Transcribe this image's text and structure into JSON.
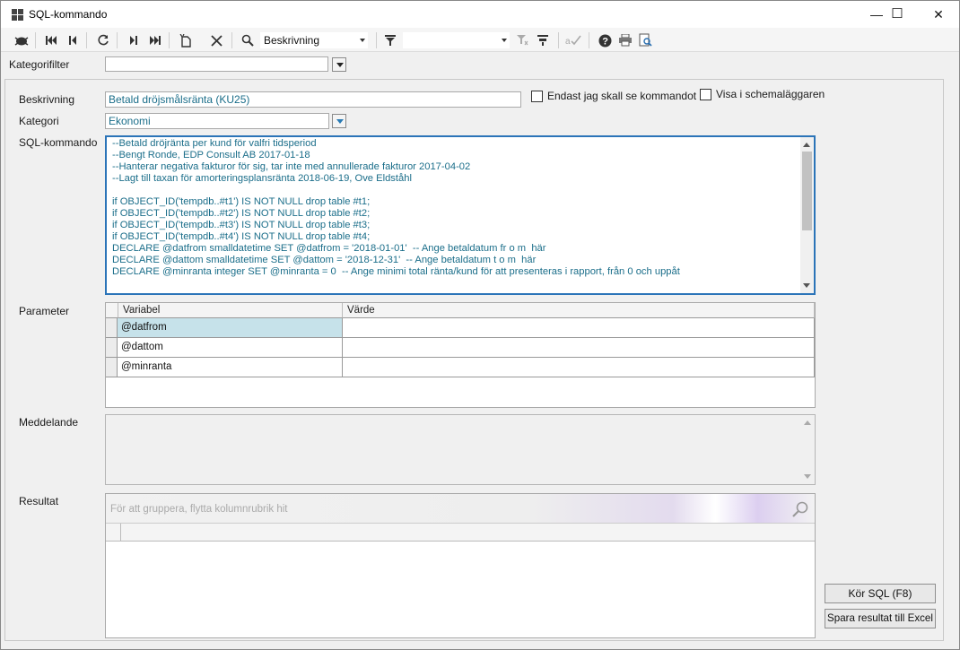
{
  "window": {
    "title": "SQL-kommando",
    "minimize": "—",
    "maximize": "☐",
    "close": "✕"
  },
  "toolbar": {
    "search_field": "Beskrivning",
    "filter_value": ""
  },
  "category_filter": {
    "label": "Kategorifilter",
    "value": ""
  },
  "form": {
    "description_label": "Beskrivning",
    "description_value": "Betald dröjsmålsränta (KU25)",
    "only_me_label": "Endast jag skall se kommandot",
    "scheduler_label": "Visa i schemaläggaren",
    "category_label": "Kategori",
    "category_value": "Ekonomi",
    "sql_label": "SQL-kommando",
    "sql_text": "--Betald dröjränta per kund för valfri tidsperiod\n--Bengt Ronde, EDP Consult AB 2017-01-18\n--Hanterar negativa fakturor för sig, tar inte med annullerade fakturor 2017-04-02\n--Lagt till taxan för amorteringsplansränta 2018-06-19, Ove Eldståhl\n\nif OBJECT_ID('tempdb..#t1') IS NOT NULL drop table #t1;\nif OBJECT_ID('tempdb..#t2') IS NOT NULL drop table #t2;\nif OBJECT_ID('tempdb..#t3') IS NOT NULL drop table #t3;\nif OBJECT_ID('tempdb..#t4') IS NOT NULL drop table #t4;\nDECLARE @datfrom smalldatetime SET @datfrom = '2018-01-01'  -- Ange betaldatum fr o m  här\nDECLARE @dattom smalldatetime SET @dattom = '2018-12-31'  -- Ange betaldatum t o m  här\nDECLARE @minranta integer SET @minranta = 0  -- Ange minimi total ränta/kund för att presenteras i rapport, från 0 och uppåt",
    "parameter_label": "Parameter",
    "columns": [
      "Variabel",
      "Värde"
    ],
    "parameters": [
      {
        "variable": "@datfrom",
        "value": ""
      },
      {
        "variable": "@dattom",
        "value": ""
      },
      {
        "variable": "@minranta",
        "value": ""
      }
    ],
    "message_label": "Meddelande",
    "result_label": "Resultat",
    "group_hint": "För att gruppera, flytta kolumnrubrik hit",
    "run_button": "Kör SQL (F8)",
    "export_button": "Spara resultat till Excel"
  }
}
